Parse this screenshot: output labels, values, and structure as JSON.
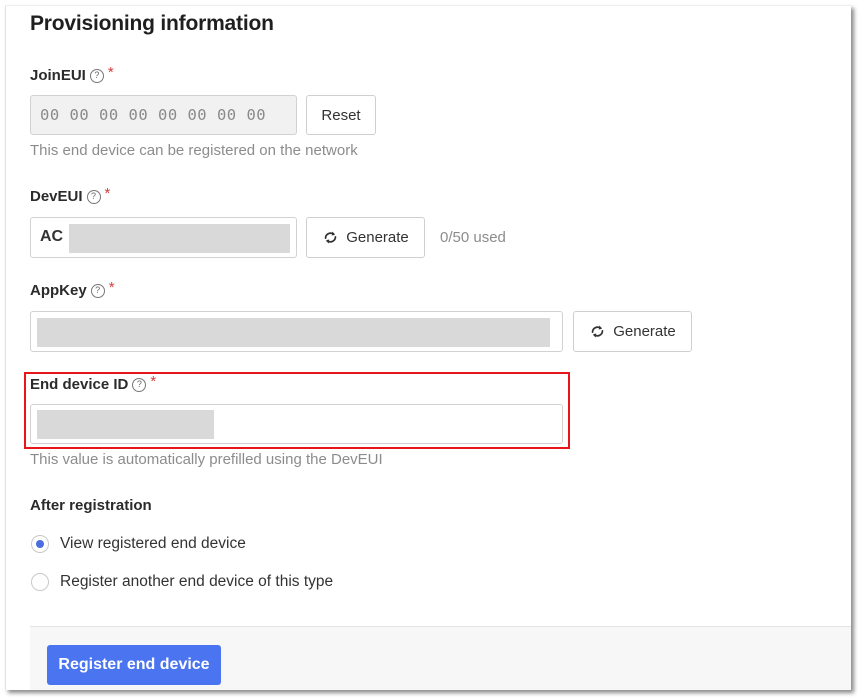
{
  "section": {
    "title": "Provisioning information"
  },
  "join_eui": {
    "label": "JoinEUI",
    "required_mark": "*",
    "help_icon": "?",
    "value": "00 00 00 00 00 00 00 00",
    "reset_label": "Reset",
    "hint": "This end device can be registered on the network"
  },
  "dev_eui": {
    "label": "DevEUI",
    "required_mark": "*",
    "help_icon": "?",
    "value_prefix": "AC",
    "generate_label": "Generate",
    "usage": "0/50 used"
  },
  "app_key": {
    "label": "AppKey",
    "required_mark": "*",
    "help_icon": "?",
    "generate_label": "Generate"
  },
  "end_device_id": {
    "label": "End device ID",
    "required_mark": "*",
    "help_icon": "?",
    "hint": "This value is automatically prefilled using the DevEUI",
    "highlight_color": "#e8161b"
  },
  "after_registration": {
    "label": "After registration",
    "options": [
      {
        "label": "View registered end device",
        "selected": true
      },
      {
        "label": "Register another end device of this type",
        "selected": false
      }
    ]
  },
  "footer": {
    "submit_label": "Register end device",
    "accent_color": "#4b74f0"
  }
}
